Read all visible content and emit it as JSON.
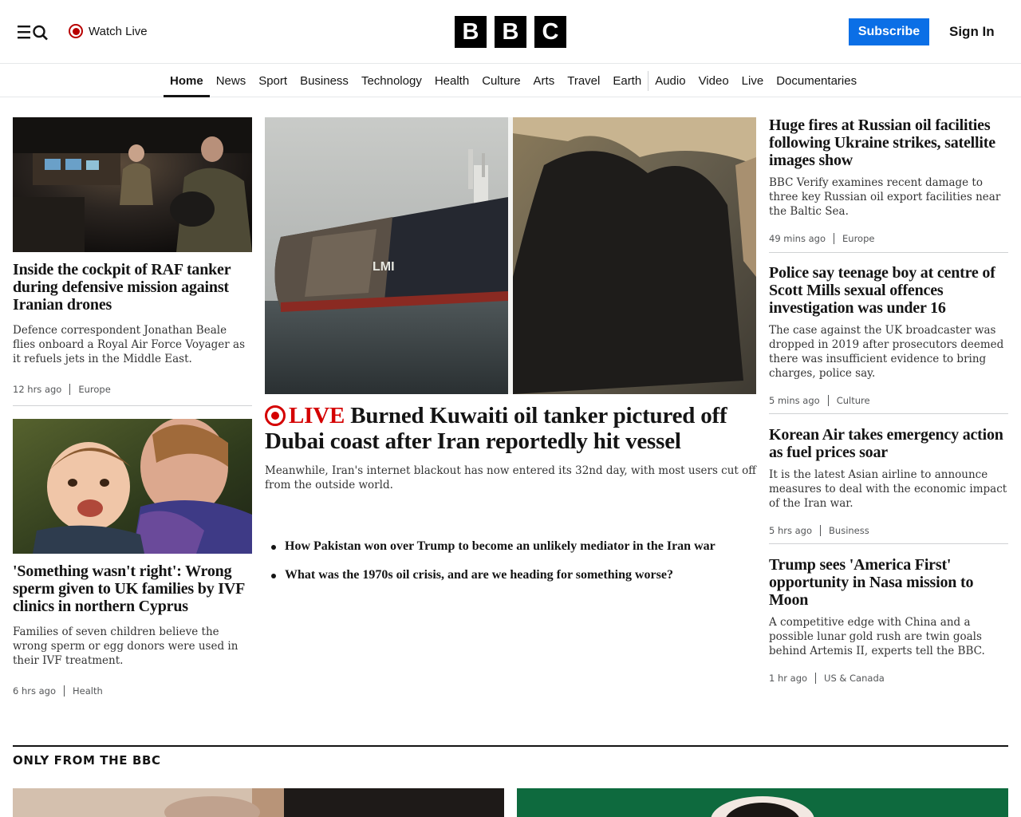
{
  "header": {
    "watch_live": "Watch Live",
    "logo": [
      "B",
      "B",
      "C"
    ],
    "subscribe": "Subscribe",
    "sign_in": "Sign In",
    "icons": [
      "menu-icon",
      "search-icon",
      "live-icon"
    ]
  },
  "nav": {
    "items": [
      "Home",
      "News",
      "Sport",
      "Business",
      "Technology",
      "Health",
      "Culture",
      "Arts",
      "Travel",
      "Earth",
      "Audio",
      "Video",
      "Live",
      "Documentaries"
    ],
    "active": "Home"
  },
  "left": {
    "story1": {
      "headline": "Inside the cockpit of RAF tanker during defensive mission against Iranian drones",
      "summary": "Defence correspondent Jonathan Beale flies onboard a Royal Air Force Voyager as it refuels jets in the Middle East.",
      "time": "12 hrs ago",
      "category": "Europe"
    },
    "story2": {
      "headline": "'Something wasn't right': Wrong sperm given to UK families by IVF clinics in northern Cyprus",
      "summary": "Families of seven children believe the wrong sperm or egg donors were used in their IVF treatment.",
      "time": "6 hrs ago",
      "category": "Health"
    }
  },
  "main": {
    "live_label": "LIVE",
    "headline": "Burned Kuwaiti oil tanker pictured off Dubai coast after Iran reportedly hit vessel",
    "summary": "Meanwhile, Iran's internet blackout has now entered its 32nd day, with most users cut off from the outside world.",
    "ship_text": "LMI",
    "related": [
      "How Pakistan won over Trump to become an unlikely mediator in the Iran war",
      "What was the 1970s oil crisis, and are we heading for something worse?"
    ]
  },
  "right": [
    {
      "headline": "Huge fires at Russian oil facilities following Ukraine strikes, satellite images show",
      "summary": "BBC Verify examines recent damage to three key Russian oil export facilities near the Baltic Sea.",
      "time": "49 mins ago",
      "category": "Europe"
    },
    {
      "headline": "Police say teenage boy at centre of Scott Mills sexual offences investigation was under 16",
      "summary": "The case against the UK broadcaster was dropped in 2019 after prosecutors deemed there was insufficient evidence to bring charges, police say.",
      "time": "5 mins ago",
      "category": "Culture"
    },
    {
      "headline": "Korean Air takes emergency action as fuel prices soar",
      "summary": "It is the latest Asian airline to announce measures to deal with the economic impact of the Iran war.",
      "time": "5 hrs ago",
      "category": "Business"
    },
    {
      "headline": "Trump sees 'America First' opportunity in Nasa mission to Moon",
      "summary": "A competitive edge with China and a possible lunar gold rush are twin goals behind Artemis II, experts tell the BBC.",
      "time": "1 hr ago",
      "category": "US & Canada"
    }
  ],
  "section": {
    "title": "ONLY FROM THE BBC"
  },
  "colors": {
    "accent_blue": "#0b6fe6",
    "live_red": "#d40000",
    "text": "#141414"
  }
}
